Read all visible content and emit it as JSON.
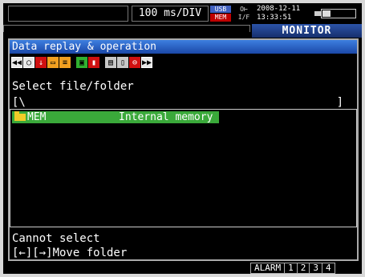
{
  "status": {
    "sampling_rate": "100 ms/DIV",
    "usb_label": "USB",
    "mem_label": "MEM",
    "if_top": "O⊢",
    "if_bottom": "I/F",
    "date": "2008-12-11",
    "time": "13:33:51"
  },
  "mode_tab": "MONITOR",
  "window": {
    "title": "Data replay & operation",
    "toolbar": [
      {
        "icon": "rewind-icon",
        "glyph": "◀◀"
      },
      {
        "icon": "search-icon",
        "glyph": "○"
      },
      {
        "icon": "download-arrow-icon",
        "glyph": "↓"
      },
      {
        "icon": "folder-icon",
        "glyph": "▭"
      },
      {
        "icon": "folder-list-icon",
        "glyph": "≡"
      },
      {
        "icon": "copy-icon",
        "glyph": "▣"
      },
      {
        "icon": "delete-icon",
        "glyph": "▮"
      },
      {
        "icon": "save-icon",
        "glyph": "▤"
      },
      {
        "icon": "document-icon",
        "glyph": "▯"
      },
      {
        "icon": "format-icon",
        "glyph": "⊖"
      },
      {
        "icon": "fast-forward-icon",
        "glyph": "▶▶"
      }
    ],
    "prompt": "Select file/folder",
    "path": "[\\",
    "path_close": "]",
    "files": [
      {
        "name": "MEM",
        "description": "Internal memory"
      }
    ],
    "message": "Cannot select",
    "hint": "[←][→]Move folder"
  },
  "bottom": {
    "alarm_label": "ALARM",
    "channels": [
      "1",
      "2",
      "3",
      "4"
    ]
  }
}
